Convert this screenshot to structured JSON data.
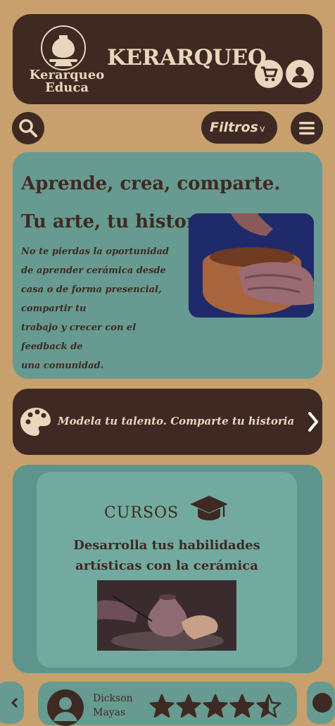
{
  "header": {
    "logo_line1": "Kerarqueo",
    "logo_line2": "Educa",
    "brand": "KERARQUEO"
  },
  "toolbar": {
    "filter_label": "Filtros",
    "filter_chevron": "v"
  },
  "hero": {
    "title": "Aprende, crea, comparte. Tu arte, tu historia.",
    "text_lines": [
      "No te pierdas la oportunidad",
      "de aprender cerámica desde",
      "casa o de forma presencial,",
      "compartir tu",
      "trabajo y crecer con el",
      "feedback de",
      "una comunidad."
    ]
  },
  "cta": {
    "text": "Modela tu talento. Comparte tu historia"
  },
  "courses": {
    "title": "CURSOS",
    "subtitle": "Desarrolla tus habilidades artísticas con la cerámica"
  },
  "review": {
    "name_first": "Dickson",
    "name_last": "Mayas",
    "rating": 4.5,
    "rating_max": 5
  },
  "colors": {
    "background": "#c7a06e",
    "dark_brown": "#3e2a22",
    "cream": "#e9d7bd",
    "teal": "#679a91"
  }
}
